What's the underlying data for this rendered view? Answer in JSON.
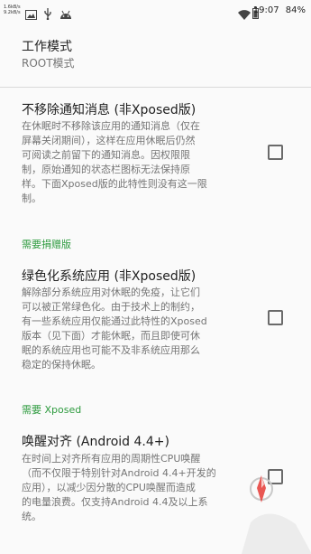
{
  "status_bar": {
    "net_speed_up": "1.6kB/s",
    "net_speed_down": "9.2kB/s",
    "time": "19:07",
    "battery": "84%",
    "icons": [
      "image-icon",
      "usb-icon",
      "android-debug-icon",
      "wifi-icon",
      "battery-icon"
    ]
  },
  "work_mode": {
    "title": "工作模式",
    "value": "ROOT模式"
  },
  "settings": [
    {
      "title": "不移除通知消息 (非Xposed版)",
      "summary_lines": [
        "在休眠时不移除该应用的通知消息（仅在",
        "屏幕关闭期间），这样在应用休眠后仍然",
        "可阅读之前留下的通知消息。因权限限",
        "制，原始通知的状态栏图标无法保持原",
        "样。下面Xposed版的此特性则没有这一限",
        "制。"
      ],
      "checked": false
    },
    {
      "category": "需要捐赠版",
      "title": "绿色化系统应用 (非Xposed版)",
      "summary_lines": [
        "解除部分系统应用对休眠的免疫，让它们",
        "可以被正常绿色化。由于技术上的制约，",
        "有一些系统应用仅能通过此特性的Xposed",
        "版本（见下面）才能休眠，而且即使可休",
        "眠的系统应用也可能不及非系统应用那么",
        "稳定的保持休眠。"
      ],
      "checked": false
    },
    {
      "category": "需要 Xposed",
      "title": "唤醒对齐 (Android 4.4+)",
      "summary_lines": [
        "在时间上对齐所有应用的周期性CPU唤醒",
        "（而不仅限于特别针对Android 4.4+开发的",
        "应用），以减少因分散的CPU唤醒而造成",
        "的电量浪费。仅支持Android 4.4及以上系",
        "统。"
      ],
      "checked": false
    }
  ],
  "colors": {
    "background": "#fafafa",
    "category_green": "#2e9b3f",
    "summary_gray": "#757575",
    "divider": "#d9d9d9"
  }
}
